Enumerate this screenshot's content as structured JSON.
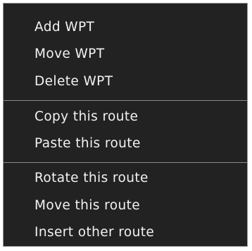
{
  "context_menu": {
    "items": [
      {
        "label": "Add WPT"
      },
      {
        "label": "Move WPT"
      },
      {
        "label": "Delete WPT"
      },
      {
        "label": "Copy this route"
      },
      {
        "label": "Paste this route"
      },
      {
        "label": "Rotate this route"
      },
      {
        "label": "Move this route"
      },
      {
        "label": "Insert other route"
      }
    ]
  },
  "colors": {
    "menu_background": "#222222",
    "text": "#f2f2f2",
    "separator": "#8a8a8a",
    "border": "#9a9a9a"
  }
}
